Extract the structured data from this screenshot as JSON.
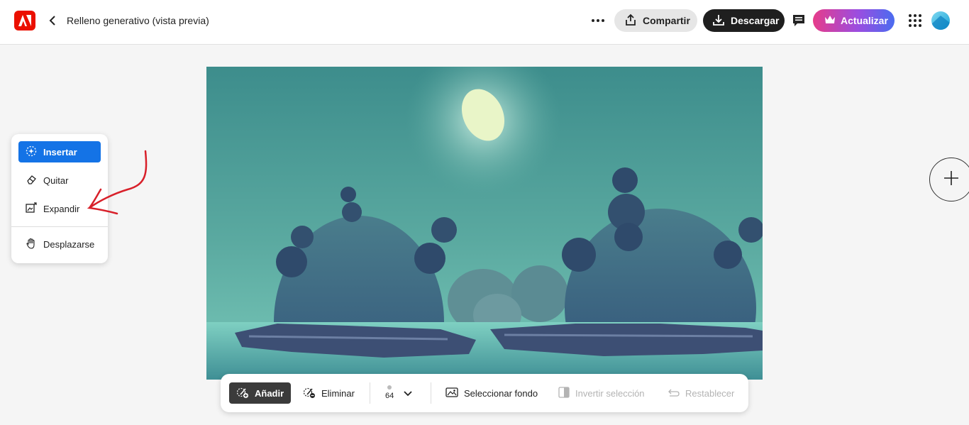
{
  "header": {
    "title": "Relleno generativo (vista previa)",
    "share_label": "Compartir",
    "download_label": "Descargar",
    "upgrade_label": "Actualizar"
  },
  "tools": [
    {
      "label": "Insertar",
      "icon": "insert-sparkle-icon",
      "active": true
    },
    {
      "label": "Quitar",
      "icon": "eraser-icon",
      "active": false
    },
    {
      "label": "Expandir",
      "icon": "expand-image-icon",
      "active": false
    },
    {
      "label": "Desplazarse",
      "icon": "hand-icon",
      "active": false
    }
  ],
  "bottombar": {
    "add_label": "Añadir",
    "remove_label": "Eliminar",
    "brush_size": "64",
    "select_bg_label": "Seleccionar fondo",
    "invert_label": "Invertir selección",
    "reset_label": "Restablecer"
  },
  "colors": {
    "accent": "#1473e6",
    "adobe_red": "#eb1000",
    "annotation": "#d8202a"
  }
}
